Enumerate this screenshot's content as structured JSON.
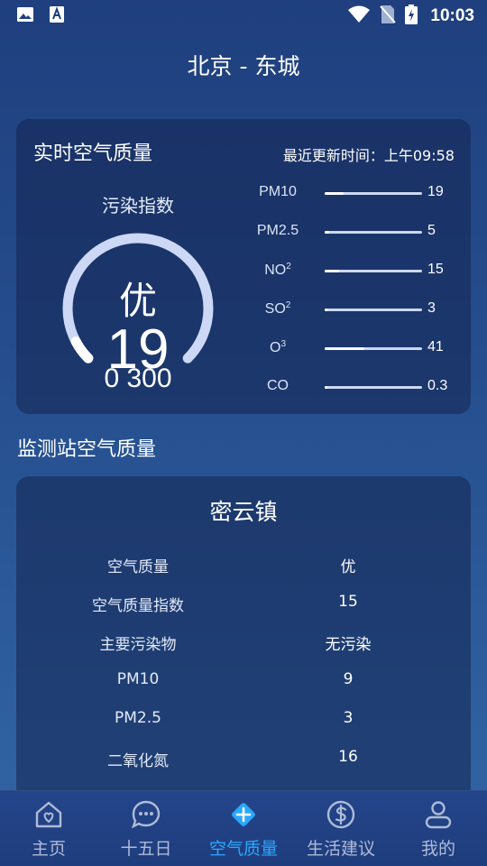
{
  "status_bar": {
    "time": "10:03",
    "icons": [
      "image-icon",
      "font-icon",
      "wifi-icon",
      "no-sim-icon",
      "battery-charging-icon"
    ]
  },
  "header": {
    "city": "北京 - 东城"
  },
  "realtime": {
    "title": "实时空气质量",
    "update_label": "最近更新时间：上午09:58",
    "aqi_label": "污染指数",
    "level": "优",
    "value": "19",
    "scale": "0 300",
    "gauge_fraction": 0.063,
    "pollutants": [
      {
        "name": "PM10",
        "sub": "",
        "value": "19",
        "fill": 0.19
      },
      {
        "name": "PM2.5",
        "sub": "",
        "value": "5",
        "fill": 0.05
      },
      {
        "name": "NO",
        "sub": "2",
        "value": "15",
        "fill": 0.15
      },
      {
        "name": "SO",
        "sub": "2",
        "value": "3",
        "fill": 0.03
      },
      {
        "name": "O",
        "sub": "3",
        "value": "41",
        "fill": 0.41
      },
      {
        "name": "CO",
        "sub": "",
        "value": "0.3",
        "fill": 0.03
      }
    ]
  },
  "stations_section": {
    "title": "监测站空气质量"
  },
  "station": {
    "name": "密云镇",
    "rows": [
      {
        "label": "空气质量",
        "value": "优"
      },
      {
        "label": "空气质量指数",
        "value": "15"
      },
      {
        "label": "主要污染物",
        "value": "无污染"
      },
      {
        "label": "PM10",
        "value": "9"
      },
      {
        "label": "PM2.5",
        "value": "3"
      },
      {
        "label": "二氧化氮",
        "value": "16"
      }
    ]
  },
  "nav": {
    "items": [
      {
        "label": "主页",
        "icon": "home-icon",
        "active": false
      },
      {
        "label": "十五日",
        "icon": "chat-icon",
        "active": false
      },
      {
        "label": "空气质量",
        "icon": "air-quality-icon",
        "active": true
      },
      {
        "label": "生活建议",
        "icon": "dollar-icon",
        "active": false
      },
      {
        "label": "我的",
        "icon": "user-icon",
        "active": false
      }
    ]
  },
  "colors": {
    "accent": "#2aa8ff",
    "gauge_track": "#ccd8f6",
    "background_top": "#1f3f7e",
    "background_bottom": "#3266a6"
  }
}
